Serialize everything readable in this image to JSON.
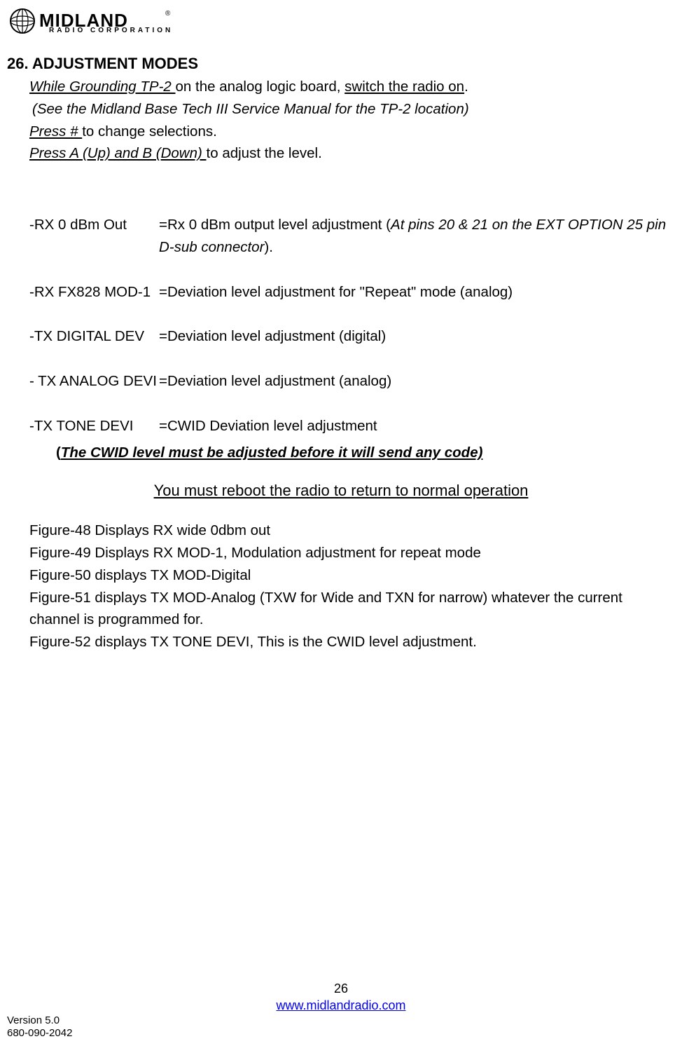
{
  "logo": {
    "brand_name": "MIDLAND",
    "subtitle": "RADIO CORPORATION",
    "registered": "®"
  },
  "heading": "26. ADJUSTMENT MODES",
  "intro": {
    "line1_u1": "While  Grounding TP-2 ",
    "line1_mid": "on the analog logic board, ",
    "line1_u2": "switch the radio on",
    "line1_end": ".",
    "line2_open": "(",
    "line2_i": "See the Midland Base Tech III Service Manual for the TP-2 location)",
    "line3_u": "Press # ",
    "line3_rest": "to change selections.",
    "line4_u": "Press A (Up) and B (Down) ",
    "line4_rest": "to adjust the level."
  },
  "modes": [
    {
      "label": "-RX 0 dBm Out",
      "desc_pre": "=Rx 0 dBm output level adjustment (",
      "desc_i": "At pins 20 & 21 on  the EXT OPTION 25 pin D-sub connector",
      "desc_post": ")."
    },
    {
      "label": "-RX FX828 MOD-1",
      "desc_pre": "=Deviation level adjustment for \"Repeat\" mode (analog)",
      "desc_i": "",
      "desc_post": ""
    },
    {
      "label": " -TX DIGITAL DEV",
      "desc_pre": "=Deviation level adjustment (digital)",
      "desc_i": "",
      "desc_post": ""
    },
    {
      "label": "- TX ANALOG DEVI",
      "desc_pre": "=Deviation level adjustment (analog)",
      "desc_i": "",
      "desc_post": ""
    },
    {
      "label": "-TX TONE DEVI",
      "desc_pre": "=CWID Deviation level adjustment",
      "desc_i": "",
      "desc_post": ""
    }
  ],
  "cwid_note_open": "(",
  "cwid_note": "The CWID level must be adjusted before it will send any code)",
  "reboot": "You must reboot the radio to return to normal operation",
  "figures": [
    "Figure-48 Displays RX wide 0dbm out",
    "Figure-49 Displays RX MOD-1, Modulation adjustment for repeat mode",
    "Figure-50 displays TX MOD-Digital",
    "Figure-51 displays TX MOD-Analog (TXW for Wide and TXN for narrow) whatever the current channel is programmed for.",
    "Figure-52 displays TX TONE DEVI, This is the CWID level adjustment."
  ],
  "footer": {
    "page_num": "26",
    "url": "www.midlandradio.com",
    "version": "Version 5.0",
    "docnum": "680-090-2042"
  }
}
